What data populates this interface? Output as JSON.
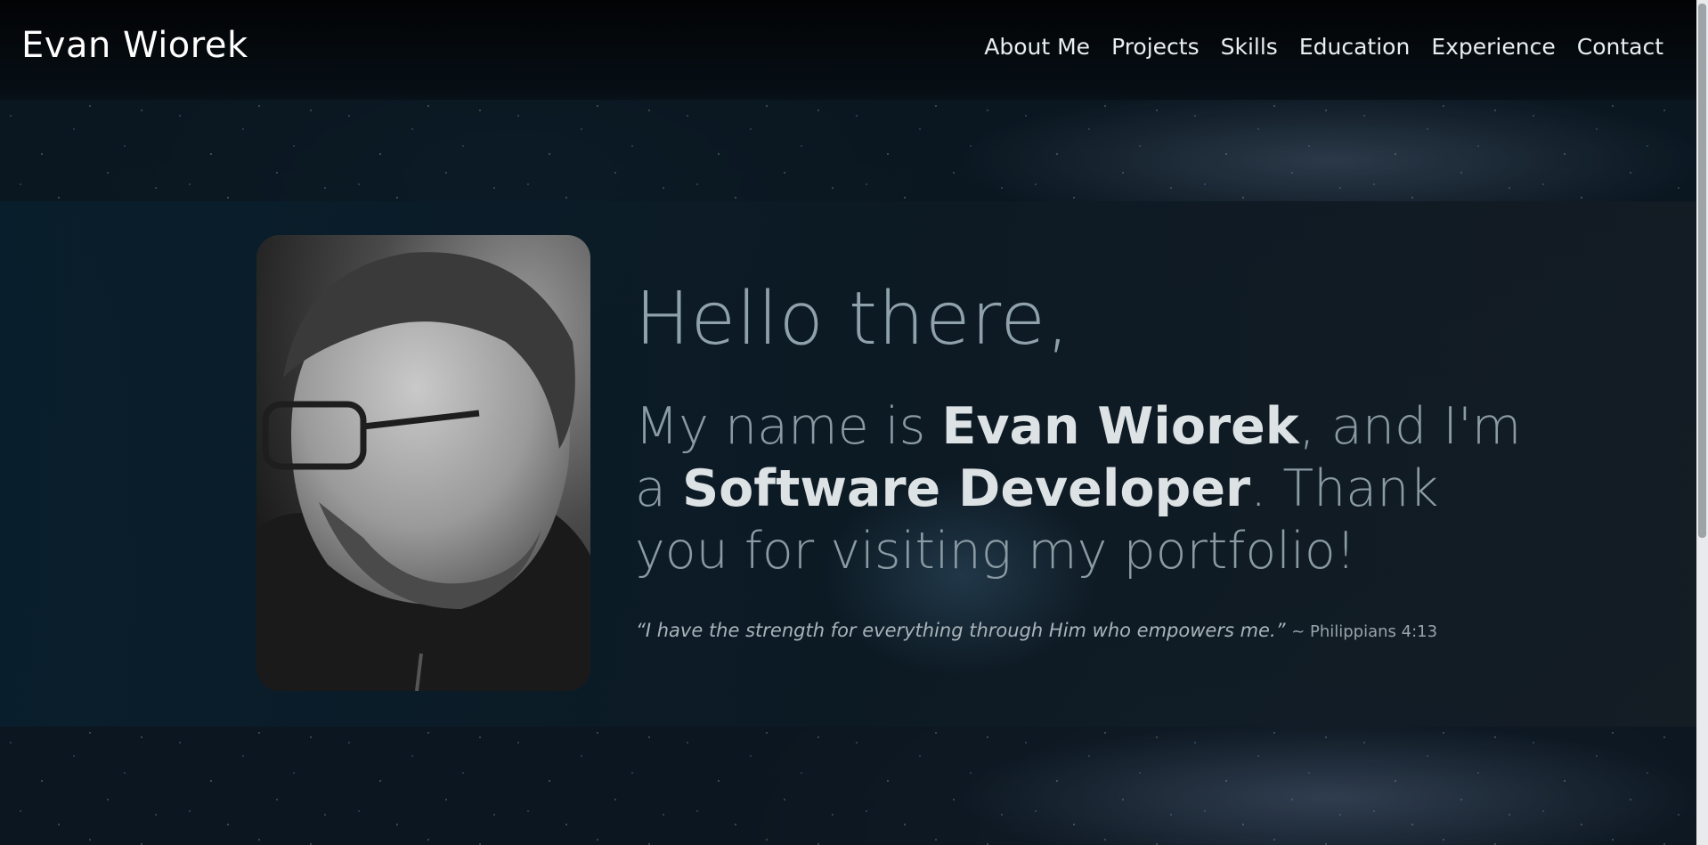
{
  "header": {
    "brand": "Evan Wiorek",
    "nav": [
      "About Me",
      "Projects",
      "Skills",
      "Education",
      "Experience",
      "Contact"
    ]
  },
  "hero": {
    "greeting": "Hello there,",
    "intro_parts": {
      "p1": "My name is ",
      "name": "Evan Wiorek",
      "p2": ", and I'm a ",
      "role": "Software Developer",
      "p3": ". Thank you for visiting my portfolio!"
    },
    "quote": "“I have the strength for everything through Him who empowers me.”",
    "quote_ref": "~ Philippians 4:13"
  },
  "colors": {
    "accent_text": "#dde2e5",
    "muted_text": "#8b9ba4",
    "background": "#0c1a24"
  }
}
